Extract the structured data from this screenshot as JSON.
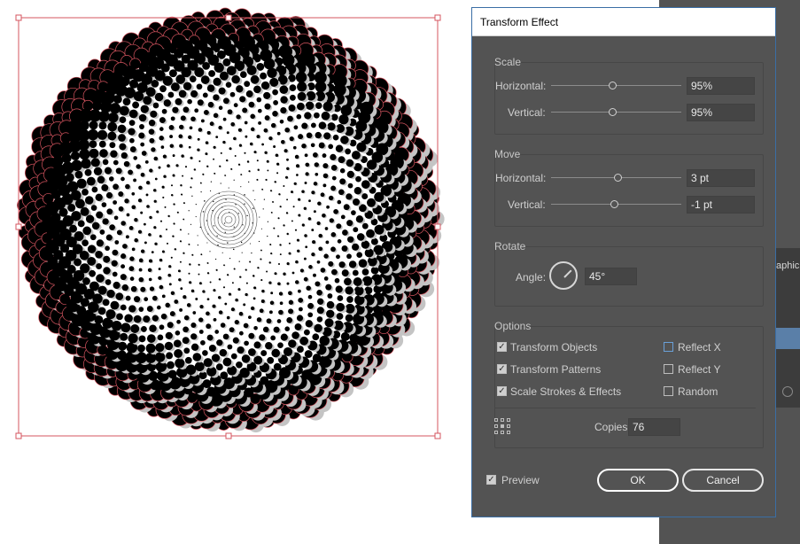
{
  "dialog": {
    "title": "Transform Effect",
    "scale": {
      "section": "Scale",
      "horizontal_label": "Horizontal:",
      "horizontal_value": "95%",
      "horizontal_level": 0.47,
      "vertical_label": "Vertical:",
      "vertical_value": "95%",
      "vertical_level": 0.47
    },
    "move": {
      "section": "Move",
      "horizontal_label": "Horizontal:",
      "horizontal_value": "3 pt",
      "horizontal_level": 0.51,
      "vertical_label": "Vertical:",
      "vertical_value": "-1 pt",
      "vertical_level": 0.48
    },
    "rotate": {
      "section": "Rotate",
      "angle_label": "Angle:",
      "angle_value": "45°"
    },
    "options": {
      "section": "Options",
      "transform_objects": "Transform Objects",
      "transform_patterns": "Transform Patterns",
      "scale_strokes": "Scale Strokes & Effects",
      "reflect_x": "Reflect X",
      "reflect_y": "Reflect Y",
      "random": "Random",
      "copies_label": "Copies",
      "copies_value": "76"
    },
    "preview_label": "Preview",
    "ok_label": "OK",
    "cancel_label": "Cancel"
  },
  "app": {
    "panel_tab": "aphic"
  },
  "colors": {
    "selection": "#d4545f",
    "dialog_bg": "#535353",
    "field_bg": "#454545"
  }
}
